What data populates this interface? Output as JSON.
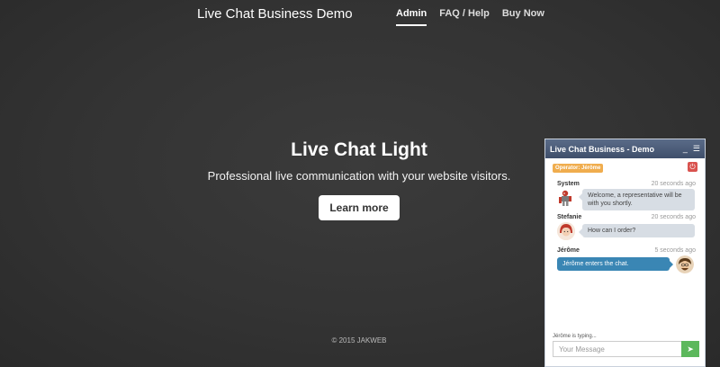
{
  "header": {
    "brand": "Live Chat Business Demo",
    "nav": [
      {
        "label": "Admin",
        "active": true
      },
      {
        "label": "FAQ / Help",
        "active": false
      },
      {
        "label": "Buy Now",
        "active": false
      }
    ]
  },
  "hero": {
    "title": "Live Chat Light",
    "subtitle": "Professional live communication with your website visitors.",
    "button": "Learn more"
  },
  "footer": {
    "text": "© 2015 JAKWEB"
  },
  "chat": {
    "title": "Live Chat Business - Demo",
    "minimize": "_",
    "menu_icon": "hamburger-icon",
    "operator_badge": "Operator: Jérôme",
    "messages": [
      {
        "sender": "System",
        "time": "20 seconds ago",
        "text": "Welcome, a representative will be with you shortly."
      },
      {
        "sender": "Stefanie",
        "time": "20 seconds ago",
        "text": "How can I order?"
      },
      {
        "sender": "Jérôme",
        "time": "5 seconds ago",
        "text": "Jérôme enters the chat."
      }
    ],
    "typing": "Jérôme is typing...",
    "input_placeholder": "Your Message",
    "colors": {
      "header": "#4a5a78",
      "operator": "#f0ad4e",
      "power": "#d9534f",
      "operator_bubble": "#3a86b4",
      "send": "#5cb85c"
    }
  }
}
